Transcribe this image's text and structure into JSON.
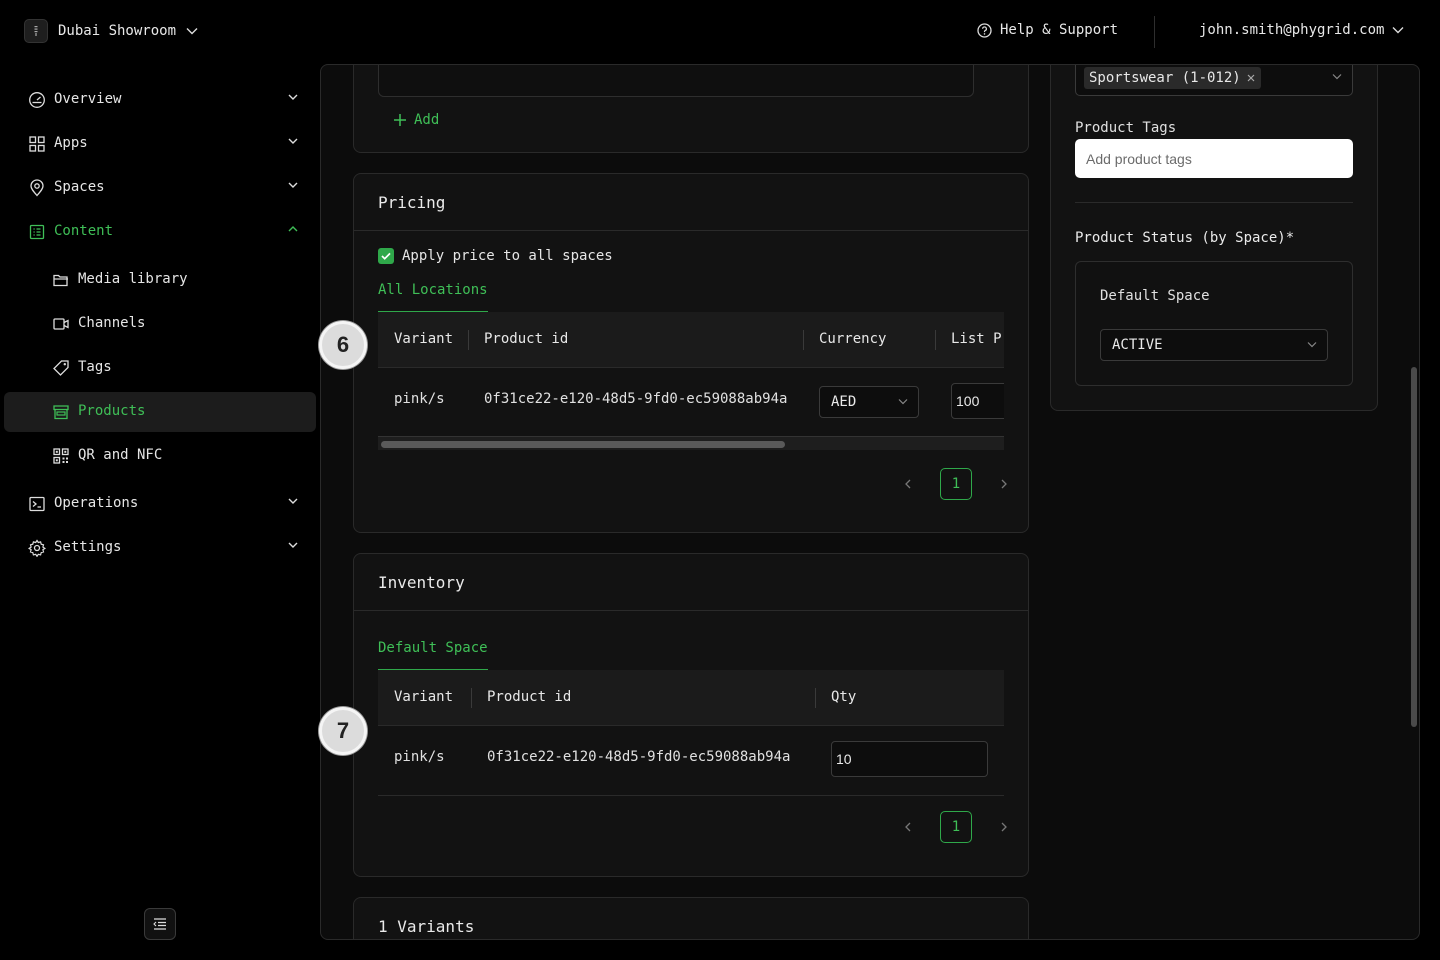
{
  "topbar": {
    "org_name": "Dubai Showroom",
    "help_label": "Help & Support",
    "user_email": "john.smith@phygrid.com"
  },
  "sidebar": {
    "items": [
      {
        "label": "Overview",
        "icon": "dashboard-icon",
        "expanded": false
      },
      {
        "label": "Apps",
        "icon": "apps-grid-icon",
        "expanded": false
      },
      {
        "label": "Spaces",
        "icon": "location-pin-icon",
        "expanded": false
      },
      {
        "label": "Content",
        "icon": "content-icon",
        "expanded": true
      }
    ],
    "sub_items": [
      {
        "label": "Media library",
        "icon": "folder-icon"
      },
      {
        "label": "Channels",
        "icon": "video-icon"
      },
      {
        "label": "Tags",
        "icon": "tag-icon"
      },
      {
        "label": "Products",
        "icon": "shop-icon",
        "active": true
      },
      {
        "label": "QR and NFC",
        "icon": "qrcode-icon"
      }
    ],
    "bottom_items": [
      {
        "label": "Operations",
        "icon": "terminal-icon"
      },
      {
        "label": "Settings",
        "icon": "gear-icon"
      }
    ]
  },
  "form": {
    "add_label": "Add",
    "pricing": {
      "title": "Pricing",
      "apply_all_label": "Apply price to all spaces",
      "apply_all_checked": true,
      "tab": "All Locations",
      "columns": [
        "Variant",
        "Product id",
        "Currency",
        "List P"
      ],
      "rows": [
        {
          "variant": "pink/s",
          "product_id": "0f31ce22-e120-48d5-9fd0-ec59088ab94a",
          "currency": "AED",
          "list_price": "100"
        }
      ],
      "page": "1"
    },
    "inventory": {
      "title": "Inventory",
      "tab": "Default Space",
      "columns": [
        "Variant",
        "Product id",
        "Qty"
      ],
      "rows": [
        {
          "variant": "pink/s",
          "product_id": "0f31ce22-e120-48d5-9fd0-ec59088ab94a",
          "qty": "10"
        }
      ],
      "page": "1"
    },
    "variants_title": "1 Variants"
  },
  "right_panel": {
    "category_chip": "Sportswear (1-012)",
    "tags_label": "Product Tags",
    "tags_placeholder": "Add product tags",
    "status_title": "Product Status (by Space)*",
    "space_name": "Default Space",
    "status_value": "ACTIVE"
  },
  "markers": [
    "6",
    "7"
  ],
  "colors": {
    "accent": "#3fbf57",
    "background": "#000000",
    "card": "#121212"
  }
}
